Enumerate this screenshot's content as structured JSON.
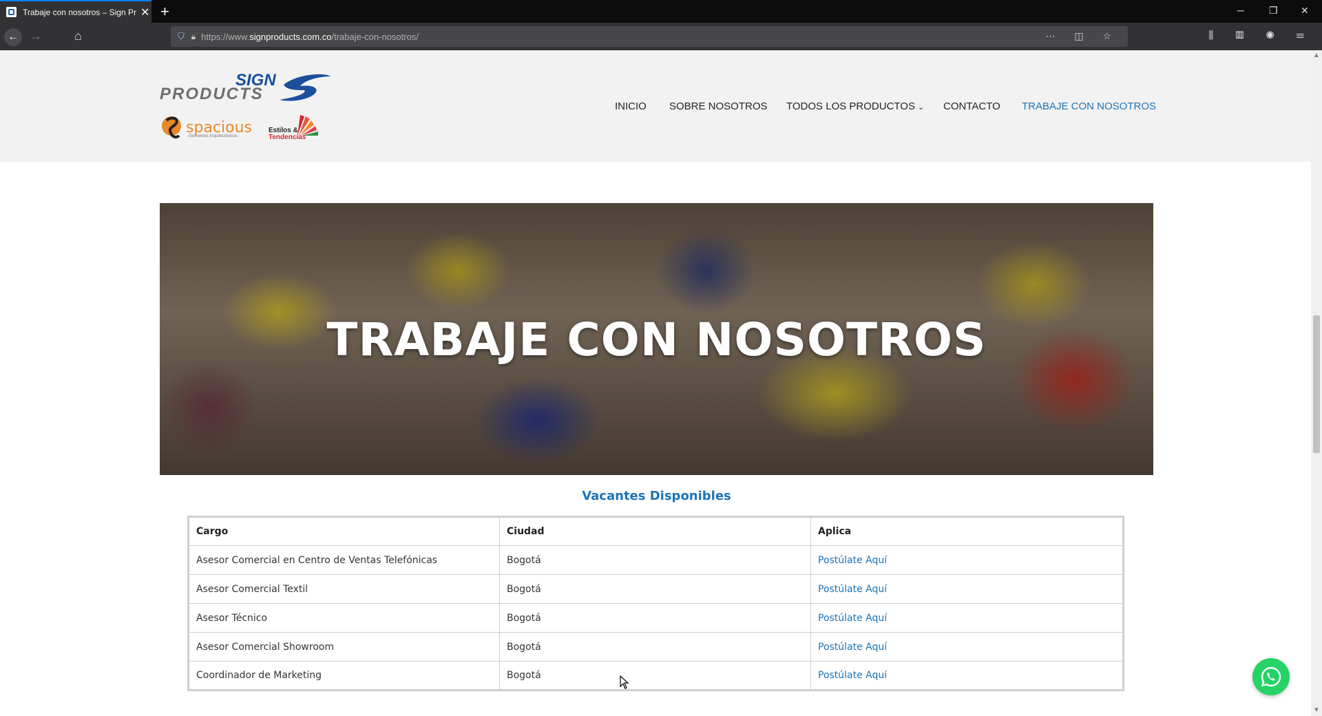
{
  "browser": {
    "tab_title": "Trabaje con nosotros – Sign Pr",
    "url_prefix": "https://www.",
    "url_domain": "signproducts.com.co",
    "url_path": "/trabaje-con-nosotros/",
    "new_tab_icon": "plus-icon",
    "window_controls": [
      "minimize-icon",
      "restore-icon",
      "close-icon"
    ]
  },
  "header": {
    "logo_sign": "SIGN",
    "logo_products": "PRODUCTS",
    "logo_spacious": "spacious",
    "logo_spacious_sub": "Elementos Arquitectónicos",
    "logo_estilos_line1": "Estilos &",
    "logo_estilos_line2": "Tendencias",
    "menu": [
      {
        "label": "INICIO",
        "active": false
      },
      {
        "label": "SOBRE NOSOTROS",
        "active": false
      },
      {
        "label": "TODOS LOS PRODUCTOS",
        "active": false,
        "has_dropdown": true
      },
      {
        "label": "CONTACTO",
        "active": false
      },
      {
        "label": "TRABAJE CON NOSOTROS",
        "active": true
      }
    ]
  },
  "hero": {
    "title": "TRABAJE CON NOSOTROS"
  },
  "vacancies": {
    "title": "Vacantes Disponibles",
    "headers": [
      "Cargo",
      "Ciudad",
      "Aplica"
    ],
    "rows": [
      [
        "Asesor Comercial en Centro de Ventas Telefónicas",
        "Bogotá",
        "Postúlate Aquí"
      ],
      [
        "Asesor Comercial Textil",
        "Bogotá",
        "Postúlate Aquí"
      ],
      [
        "Asesor Técnico",
        "Bogotá",
        "Postúlate Aquí"
      ],
      [
        "Asesor Comercial Showroom",
        "Bogotá",
        "Postúlate Aquí"
      ],
      [
        "Coordinador de Marketing",
        "Bogotá",
        "Postúlate Aquí"
      ]
    ]
  },
  "colors": {
    "accent": "#1a74b8",
    "whatsapp": "#25d366"
  },
  "floating": {
    "whatsapp_icon": "whatsapp-icon"
  }
}
